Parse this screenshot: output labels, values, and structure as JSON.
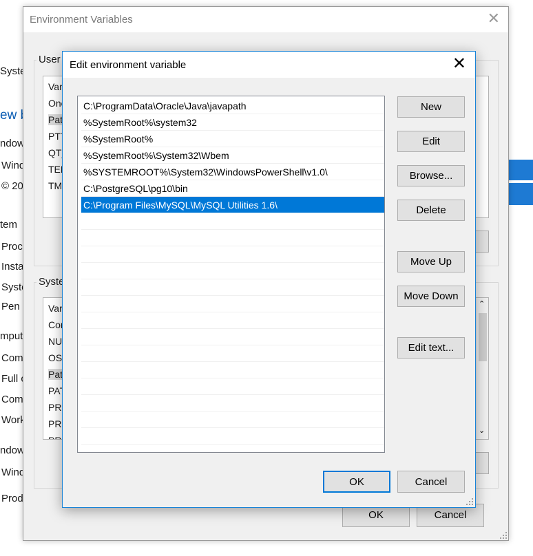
{
  "background_window": {
    "fragments": [
      "Syster",
      "ew b",
      "ndows",
      "Wind",
      "© 20",
      "tem",
      "Proce",
      "Insta",
      "Syste",
      "Pen a",
      "mpute",
      "Com",
      "Full c",
      "Com",
      "Work",
      "ndows",
      "Wind",
      "Prod"
    ]
  },
  "env_dialog": {
    "title": "Environment Variables",
    "user_group_label": "User",
    "user_rows": [
      "Var",
      "One",
      "Pat",
      "PT7",
      "QT_",
      "TEM",
      "TMI"
    ],
    "system_group_label": "Syste",
    "system_rows": [
      "Var",
      "Cor",
      "NU",
      "OS",
      "Pat",
      "PAT",
      "PRO",
      "PRO",
      "PR"
    ],
    "ok_label": "OK",
    "cancel_label": "Cancel"
  },
  "edit_dialog": {
    "title": "Edit environment variable",
    "paths": [
      "C:\\ProgramData\\Oracle\\Java\\javapath",
      "%SystemRoot%\\system32",
      "%SystemRoot%",
      "%SystemRoot%\\System32\\Wbem",
      "%SYSTEMROOT%\\System32\\WindowsPowerShell\\v1.0\\",
      "C:\\PostgreSQL\\pg10\\bin",
      "C:\\Program Files\\MySQL\\MySQL Utilities 1.6\\"
    ],
    "selected_index": 6,
    "buttons": {
      "new": "New",
      "edit": "Edit",
      "browse": "Browse...",
      "delete": "Delete",
      "move_up": "Move Up",
      "move_down": "Move Down",
      "edit_text": "Edit text...",
      "ok": "OK",
      "cancel": "Cancel"
    }
  },
  "colors": {
    "selection": "#0078d7",
    "dialog_bg": "#f0f0f0",
    "button_bg": "#e1e1e1",
    "accent_border": "#1883d7",
    "link_blue": "#0a5cb3",
    "windows_logo": "#1e7ad3"
  },
  "icons": [
    "close-icon",
    "resize-grip-icon",
    "scroll-up-icon",
    "scroll-down-icon"
  ]
}
